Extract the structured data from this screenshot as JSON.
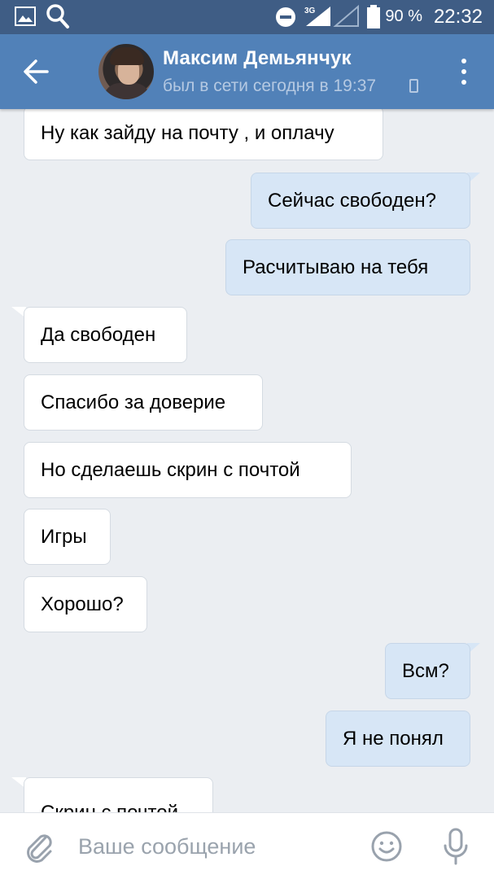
{
  "status_bar": {
    "network": "3G",
    "battery": "90 %",
    "time": "22:32"
  },
  "header": {
    "contact_name": "Максим Демьянчук",
    "contact_status": "был в сети сегодня в 19:37"
  },
  "messages": [
    {
      "text": "Ну как зайду на почту , и оплачу",
      "direction": "in"
    },
    {
      "text": "Сейчас свободен?",
      "direction": "out"
    },
    {
      "text": "Расчитываю на тебя",
      "direction": "out"
    },
    {
      "text": "Да свободен",
      "direction": "in"
    },
    {
      "text": "Спасибо за доверие",
      "direction": "in"
    },
    {
      "text": "Но сделаешь скрин с почтой",
      "direction": "in"
    },
    {
      "text": "Игры",
      "direction": "in"
    },
    {
      "text": "Хорошо?",
      "direction": "in"
    },
    {
      "text": "Всм?",
      "direction": "out"
    },
    {
      "text": "Я не понял",
      "direction": "out"
    },
    {
      "text": "Скрин с почтой",
      "direction": "in"
    }
  ],
  "composer": {
    "placeholder": "Ваше сообщение"
  },
  "colors": {
    "header": "#5181b8",
    "status_bar": "#3f5d85",
    "outgoing_bubble": "#d7e6f6",
    "incoming_bubble": "#ffffff",
    "background": "#ebeef2"
  },
  "icons": [
    "gallery-icon",
    "search-icon",
    "dnd-icon",
    "signal-icon",
    "battery-icon",
    "back-arrow-icon",
    "phone-icon",
    "more-vert-icon",
    "paperclip-icon",
    "emoji-icon",
    "microphone-icon"
  ]
}
